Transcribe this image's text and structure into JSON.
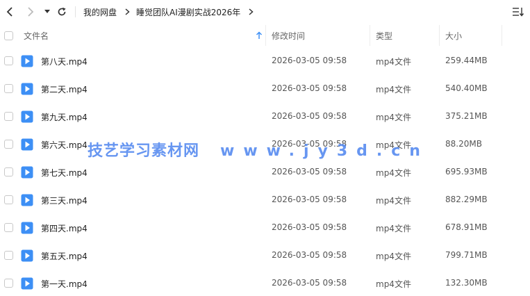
{
  "toolbar": {
    "back_icon": "back-arrow-icon",
    "forward_icon": "forward-arrow-icon",
    "history_icon": "dropdown-triangle-icon",
    "refresh_icon": "refresh-icon",
    "sort_icon": "sort-list-icon"
  },
  "breadcrumb": {
    "items": [
      "我的网盘",
      "睡觉团队AI漫剧实战2026年"
    ]
  },
  "columns": {
    "name": "文件名",
    "modified": "修改时间",
    "type": "类型",
    "size": "大小"
  },
  "files": [
    {
      "name": "第八天.mp4",
      "modified": "2026-03-05 09:58",
      "type": "mp4文件",
      "size": "259.44MB"
    },
    {
      "name": "第二天.mp4",
      "modified": "2026-03-05 09:58",
      "type": "mp4文件",
      "size": "540.40MB"
    },
    {
      "name": "第九天.mp4",
      "modified": "2026-03-05 09:58",
      "type": "mp4文件",
      "size": "375.21MB"
    },
    {
      "name": "第六天.mp4",
      "modified": "2026-03-05 09:58",
      "type": "mp4文件",
      "size": "88.20MB"
    },
    {
      "name": "第七天.mp4",
      "modified": "2026-03-05 09:58",
      "type": "mp4文件",
      "size": "695.93MB"
    },
    {
      "name": "第三天.mp4",
      "modified": "2026-03-05 09:58",
      "type": "mp4文件",
      "size": "882.29MB"
    },
    {
      "name": "第四天.mp4",
      "modified": "2026-03-05 09:58",
      "type": "mp4文件",
      "size": "678.91MB"
    },
    {
      "name": "第五天.mp4",
      "modified": "2026-03-05 09:58",
      "type": "mp4文件",
      "size": "799.71MB"
    },
    {
      "name": "第一天.mp4",
      "modified": "2026-03-05 09:58",
      "type": "mp4文件",
      "size": "132.30MB"
    }
  ],
  "watermark": {
    "part1": "技艺学习素材网",
    "part2": "www.jy3d.cn"
  },
  "colors": {
    "file_icon": "#3d8ff5",
    "watermark": "#5b8ef0",
    "sort_arrow": "#3d8ff5"
  }
}
